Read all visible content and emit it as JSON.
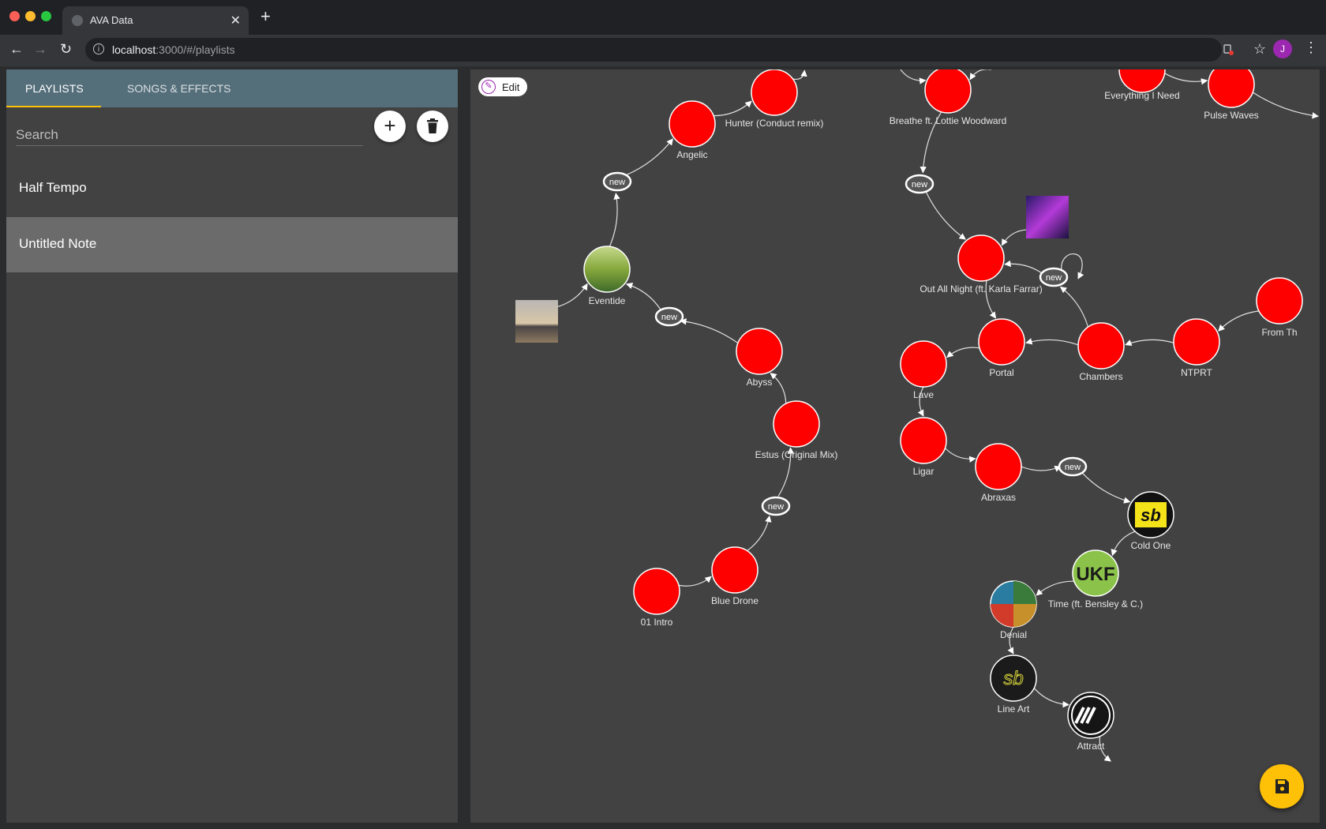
{
  "browser": {
    "tab_title": "AVA Data",
    "close_glyph": "✕",
    "new_tab_glyph": "+",
    "url_host": "localhost",
    "url_path": ":3000/#/playlists",
    "avatar_initial": "J",
    "back_glyph": "←",
    "forward_glyph": "→",
    "reload_glyph": "↻",
    "star_glyph": "☆",
    "menu_glyph": "⋮",
    "info_glyph": "i"
  },
  "sidebar": {
    "tabs": [
      {
        "label": "PLAYLISTS",
        "active": true
      },
      {
        "label": "SONGS & EFFECTS",
        "active": false
      }
    ],
    "search_placeholder": "Search",
    "add_glyph": "+",
    "delete_glyph": "🗑",
    "playlists": [
      {
        "label": "Half Tempo",
        "selected": false
      },
      {
        "label": "Untitled Note",
        "selected": true
      }
    ]
  },
  "canvas": {
    "edit_label": "Edit",
    "node_color": "#ff0000",
    "nodes": [
      {
        "id": "intro",
        "label": "01 Intro",
        "kind": "song"
      },
      {
        "id": "bluedrone",
        "label": "Blue Drone",
        "kind": "song"
      },
      {
        "id": "estus",
        "label": "Estus (Original Mix)",
        "kind": "song"
      },
      {
        "id": "abyss",
        "label": "Abyss",
        "kind": "song"
      },
      {
        "id": "eventide",
        "label": "Eventide",
        "kind": "art"
      },
      {
        "id": "angelic",
        "label": "Angelic",
        "kind": "song"
      },
      {
        "id": "hunter",
        "label": "Hunter (Conduct remix)",
        "kind": "song"
      },
      {
        "id": "breathe",
        "label": "Breathe ft. Lottie Woodward",
        "kind": "song"
      },
      {
        "id": "everything",
        "label": "Everything I Need",
        "kind": "song"
      },
      {
        "id": "pulse",
        "label": "Pulse Waves",
        "kind": "song"
      },
      {
        "id": "outallnight",
        "label": "Out All Night (ft. Karla Farrar)",
        "kind": "song"
      },
      {
        "id": "portal",
        "label": "Portal",
        "kind": "song"
      },
      {
        "id": "chambers",
        "label": "Chambers",
        "kind": "song"
      },
      {
        "id": "ntprt",
        "label": "NTPRT",
        "kind": "song"
      },
      {
        "id": "fromth",
        "label": "From Th",
        "kind": "song"
      },
      {
        "id": "lave",
        "label": "Lave",
        "kind": "song"
      },
      {
        "id": "ligar",
        "label": "Ligar",
        "kind": "song"
      },
      {
        "id": "abraxas",
        "label": "Abraxas",
        "kind": "song"
      },
      {
        "id": "coldone",
        "label": "Cold One",
        "kind": "art"
      },
      {
        "id": "time",
        "label": "Time (ft. Bensley & C.)",
        "kind": "art"
      },
      {
        "id": "denial",
        "label": "Denial",
        "kind": "art"
      },
      {
        "id": "lineart",
        "label": "Line Art",
        "kind": "art"
      },
      {
        "id": "attract",
        "label": "Attract",
        "kind": "art"
      }
    ],
    "new_label": "new",
    "logo_text_ukf": "UKF",
    "logo_text_sb": "sb"
  }
}
